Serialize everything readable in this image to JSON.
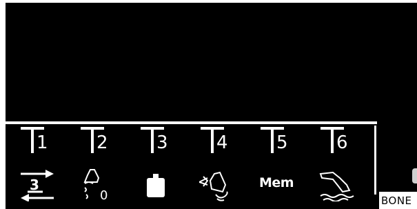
{
  "tools": [
    {
      "letter": "T",
      "number": "1",
      "icon": "wiper-three-speed-icon",
      "icon_label": "3"
    },
    {
      "letter": "T",
      "number": "2",
      "icon": "bucket-zero-icon",
      "icon_label": "0"
    },
    {
      "letter": "T",
      "number": "3",
      "icon": "hammer-weight-icon",
      "icon_label": ""
    },
    {
      "letter": "T",
      "number": "4",
      "icon": "bucket-rotate-icon",
      "icon_label": ""
    },
    {
      "letter": "T",
      "number": "5",
      "icon": "memory-icon",
      "icon_label": "Mem"
    },
    {
      "letter": "T",
      "number": "6",
      "icon": "excavator-arm-icon",
      "icon_label": ""
    }
  ],
  "watermark": "BONE",
  "colors": {
    "screen_background": "#000000",
    "foreground": "#ffffff",
    "frame": "#ffffff"
  }
}
